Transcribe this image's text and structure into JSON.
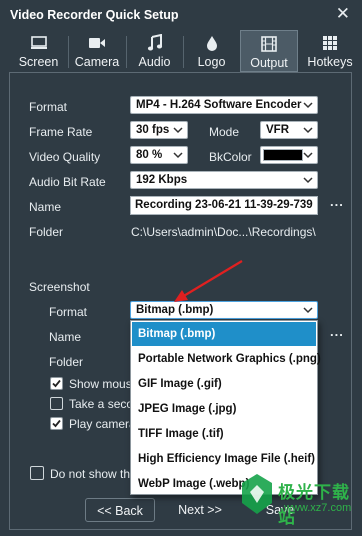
{
  "window": {
    "title": "Video Recorder Quick Setup",
    "close_glyph": "✕"
  },
  "tabs": [
    {
      "label": "Screen",
      "icon": "monitor-icon"
    },
    {
      "label": "Camera",
      "icon": "camera-icon"
    },
    {
      "label": "Audio",
      "icon": "music-note-icon"
    },
    {
      "label": "Logo",
      "icon": "droplet-icon"
    },
    {
      "label": "Output",
      "icon": "film-icon",
      "active": true
    },
    {
      "label": "Hotkeys",
      "icon": "keyboard-icon"
    }
  ],
  "output": {
    "format_label": "Format",
    "format_value": "MP4 - H.264 Software Encoder",
    "frame_rate_label": "Frame Rate",
    "frame_rate_value": "30 fps",
    "mode_label": "Mode",
    "mode_value": "VFR",
    "video_quality_label": "Video Quality",
    "video_quality_value": "80 %",
    "bkcolor_label": "BkColor",
    "bkcolor_value": "#000000",
    "audio_bitrate_label": "Audio Bit Rate",
    "audio_bitrate_value": "192 Kbps",
    "name_label": "Name",
    "name_value": "Recording 23-06-21 11-39-29-739",
    "name_browse": "...",
    "folder_label": "Folder",
    "folder_value": "C:\\Users\\admin\\Doc...\\Recordings\\"
  },
  "screenshot": {
    "section_label": "Screenshot",
    "format_label": "Format",
    "format_value": "Bitmap (.bmp)",
    "name_label": "Name",
    "name_browse": "...",
    "folder_label": "Folder",
    "show_mouse_label": "Show mouse",
    "show_mouse_checked": true,
    "take_second_label": "Take a secon",
    "take_second_checked": false,
    "play_camera_label": "Play camera",
    "play_camera_checked": true,
    "format_options": [
      "Bitmap (.bmp)",
      "Portable Network Graphics (.png)",
      "GIF Image (.gif)",
      "JPEG Image (.jpg)",
      "TIFF Image (.tif)",
      "High Efficiency Image File (.heif)",
      "WebP Image (.webp)"
    ],
    "selected_option_index": 0
  },
  "footer": {
    "dont_show_label": "Do not show th",
    "dont_show_checked": false,
    "back_label": "<< Back",
    "next_label": "Next >>",
    "save_label": "Save"
  },
  "watermark": {
    "text": "极光下载站",
    "url": "www.xz7.com"
  },
  "colors": {
    "background": "#2f3b44",
    "selection": "#1f8fc9",
    "annotation_arrow": "#e02020"
  }
}
